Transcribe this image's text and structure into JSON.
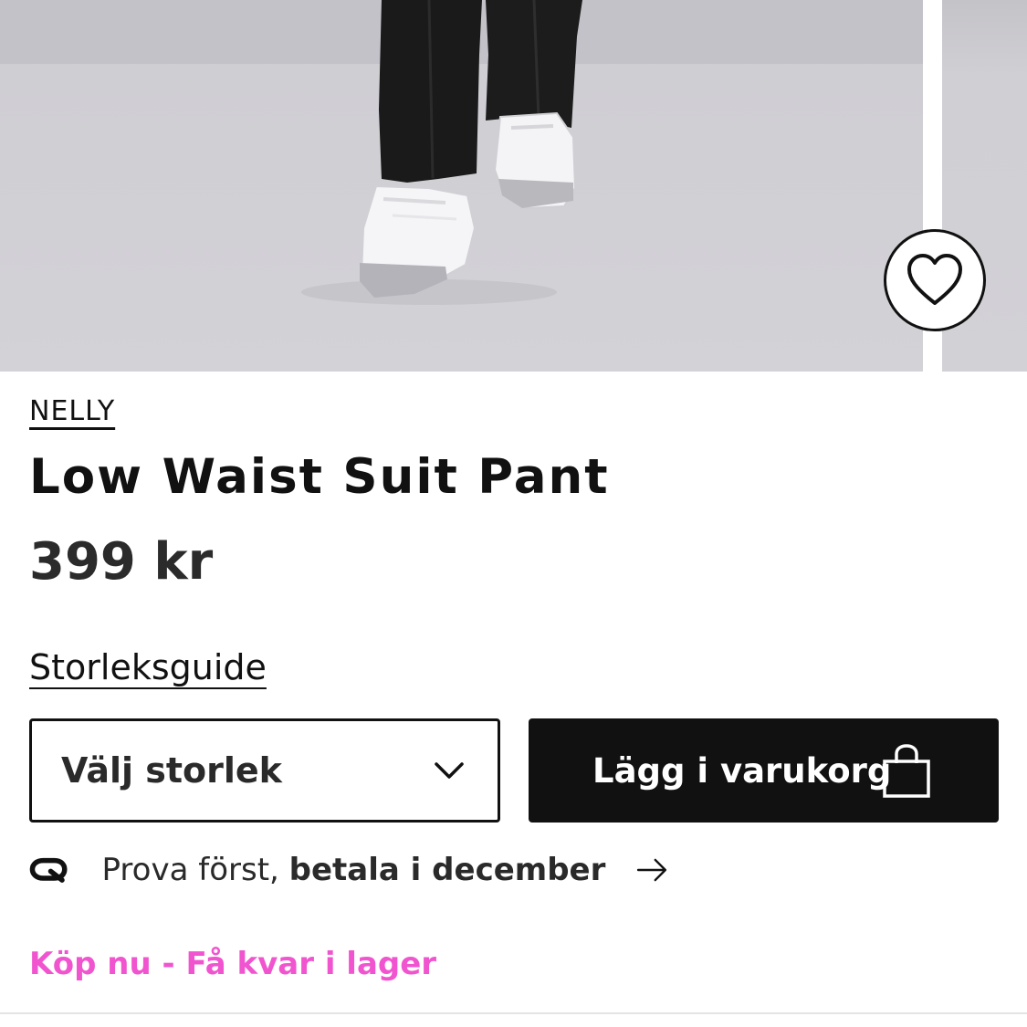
{
  "product": {
    "brand": "NELLY",
    "title": "Low Waist Suit Pant",
    "price": "399 kr"
  },
  "size": {
    "guide_label": "Storleksguide",
    "select_label": "Välj storlek"
  },
  "cart": {
    "add_label": "Lägg i varukorg"
  },
  "payment": {
    "text_regular": "Prova först, ",
    "text_bold": "betala i december"
  },
  "stock": {
    "note": "Köp nu - Få kvar i lager"
  },
  "colors": {
    "accent_pink": "#f055cf",
    "button_dark": "#111111"
  },
  "icons": {
    "favorite": "heart-icon",
    "dropdown": "chevron-down-icon",
    "cart": "shopping-bag-icon",
    "payment": "klarna-logo-icon",
    "go": "arrow-right-icon"
  }
}
